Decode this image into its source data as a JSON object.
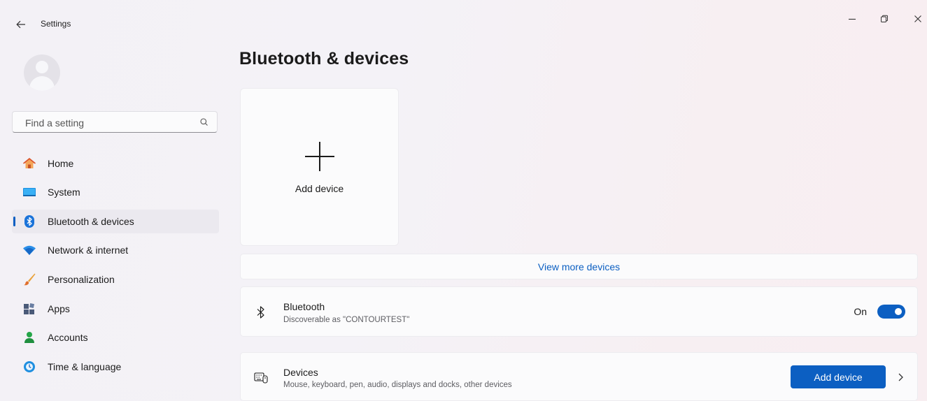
{
  "window": {
    "title": "Settings",
    "controls": [
      "minimize",
      "restore",
      "close"
    ]
  },
  "search": {
    "placeholder": "Find a setting"
  },
  "sidebar": {
    "items": [
      {
        "label": "Home",
        "icon": "home-icon",
        "active": false
      },
      {
        "label": "System",
        "icon": "system-icon",
        "active": false
      },
      {
        "label": "Bluetooth & devices",
        "icon": "bluetooth-icon",
        "active": true
      },
      {
        "label": "Network & internet",
        "icon": "wifi-icon",
        "active": false
      },
      {
        "label": "Personalization",
        "icon": "brush-icon",
        "active": false
      },
      {
        "label": "Apps",
        "icon": "apps-icon",
        "active": false
      },
      {
        "label": "Accounts",
        "icon": "person-icon",
        "active": false
      },
      {
        "label": "Time & language",
        "icon": "globe-clock-icon",
        "active": false
      }
    ]
  },
  "main": {
    "title": "Bluetooth & devices",
    "add_card_label": "Add device",
    "view_more": "View more devices",
    "bluetooth": {
      "title": "Bluetooth",
      "subtitle": "Discoverable as \"CONTOURTEST\"",
      "state_text": "On",
      "enabled": true
    },
    "devices": {
      "title": "Devices",
      "subtitle": "Mouse, keyboard, pen, audio, displays and docks, other devices",
      "button": "Add device"
    }
  },
  "colors": {
    "accent": "#0c5fc2",
    "background": "#f3f1f6",
    "card": "#fbfbfc"
  }
}
